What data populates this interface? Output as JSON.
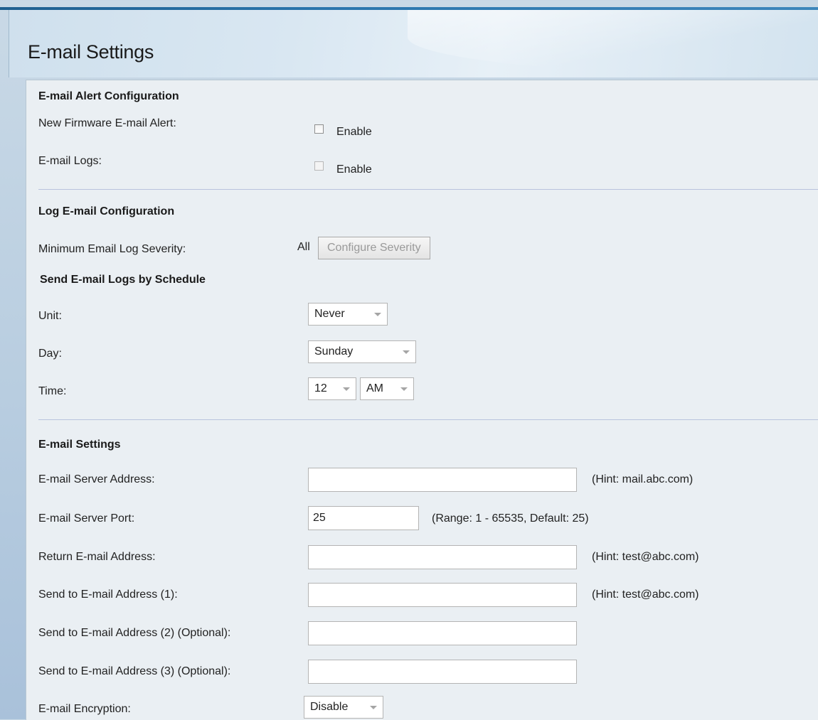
{
  "page": {
    "title": "E-mail Settings"
  },
  "alert_config": {
    "section_title": "E-mail Alert Configuration",
    "firmware_label": "New Firmware E-mail Alert:",
    "firmware_enable": "Enable",
    "firmware_checked": false,
    "logs_label": "E-mail Logs:",
    "logs_enable": "Enable",
    "logs_checked": false
  },
  "log_config": {
    "section_title": "Log E-mail Configuration",
    "severity_label": "Minimum Email Log Severity:",
    "severity_value": "All",
    "configure_button": "Configure Severity"
  },
  "schedule": {
    "section_title": "Send E-mail Logs by Schedule",
    "unit_label": "Unit:",
    "unit_value": "Never",
    "day_label": "Day:",
    "day_value": "Sunday",
    "time_label": "Time:",
    "time_hour": "12",
    "time_ampm": "AM"
  },
  "email_settings": {
    "section_title": "E-mail Settings",
    "server_address_label": "E-mail Server Address:",
    "server_address_value": "",
    "server_address_hint": "(Hint: mail.abc.com)",
    "server_port_label": "E-mail Server Port:",
    "server_port_value": "25",
    "server_port_hint": "(Range: 1 - 65535, Default: 25)",
    "return_address_label": "Return E-mail Address:",
    "return_address_value": "",
    "return_address_hint": "(Hint: test@abc.com)",
    "send_to_1_label": "Send to E-mail Address (1):",
    "send_to_1_value": "",
    "send_to_1_hint": "(Hint: test@abc.com)",
    "send_to_2_label": "Send to E-mail Address (2) (Optional):",
    "send_to_2_value": "",
    "send_to_3_label": "Send to E-mail Address (3) (Optional):",
    "send_to_3_value": "",
    "encryption_label": "E-mail Encryption:",
    "encryption_value": "Disable"
  }
}
